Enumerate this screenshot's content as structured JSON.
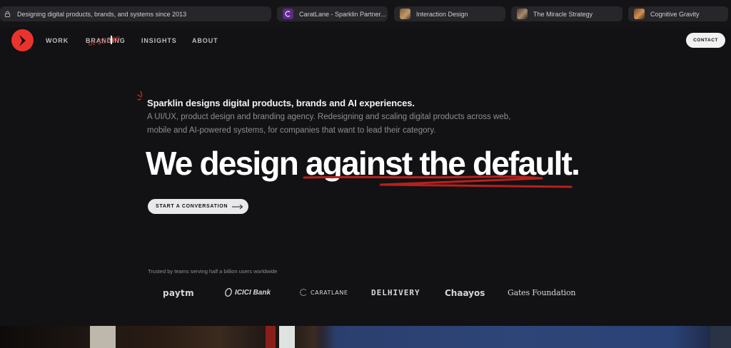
{
  "browser": {
    "tabs": [
      {
        "title": "Designing digital products, brands, and systems since 2013",
        "icon": "lock-icon"
      },
      {
        "title": "CaratLane - Sparklin Partner...",
        "icon": "caratlane-favicon"
      },
      {
        "title": "Interaction Design",
        "icon": "thumbnail-favicon"
      },
      {
        "title": "The Miracle Strategy",
        "icon": "thumbnail-favicon"
      },
      {
        "title": "Cognitive Gravity",
        "icon": "thumbnail-favicon"
      }
    ]
  },
  "header": {
    "nav": [
      "WORK",
      "BRANDING",
      "INSIGHTS",
      "ABOUT"
    ],
    "price_note": "at $3500",
    "contact_label": "CONTACT",
    "brand_color": "#e8342d"
  },
  "hero": {
    "lead": "Sparklin designs digital products, brands and AI experiences.",
    "sub": "A UI/UX, product design and branding agency. Redesigning and scaling digital products across web, mobile and AI-powered systems, for companies that want to lead their category.",
    "headline": "We design against the default.",
    "cta_label": "START A CONVERSATION"
  },
  "trusted": {
    "caption": "Trusted by teams serving half a billion users worldwide",
    "logos": [
      "paytm",
      "ICICI Bank",
      "CARATLANE",
      "DELHIVERY",
      "Chaayos",
      "Gates Foundation"
    ]
  }
}
